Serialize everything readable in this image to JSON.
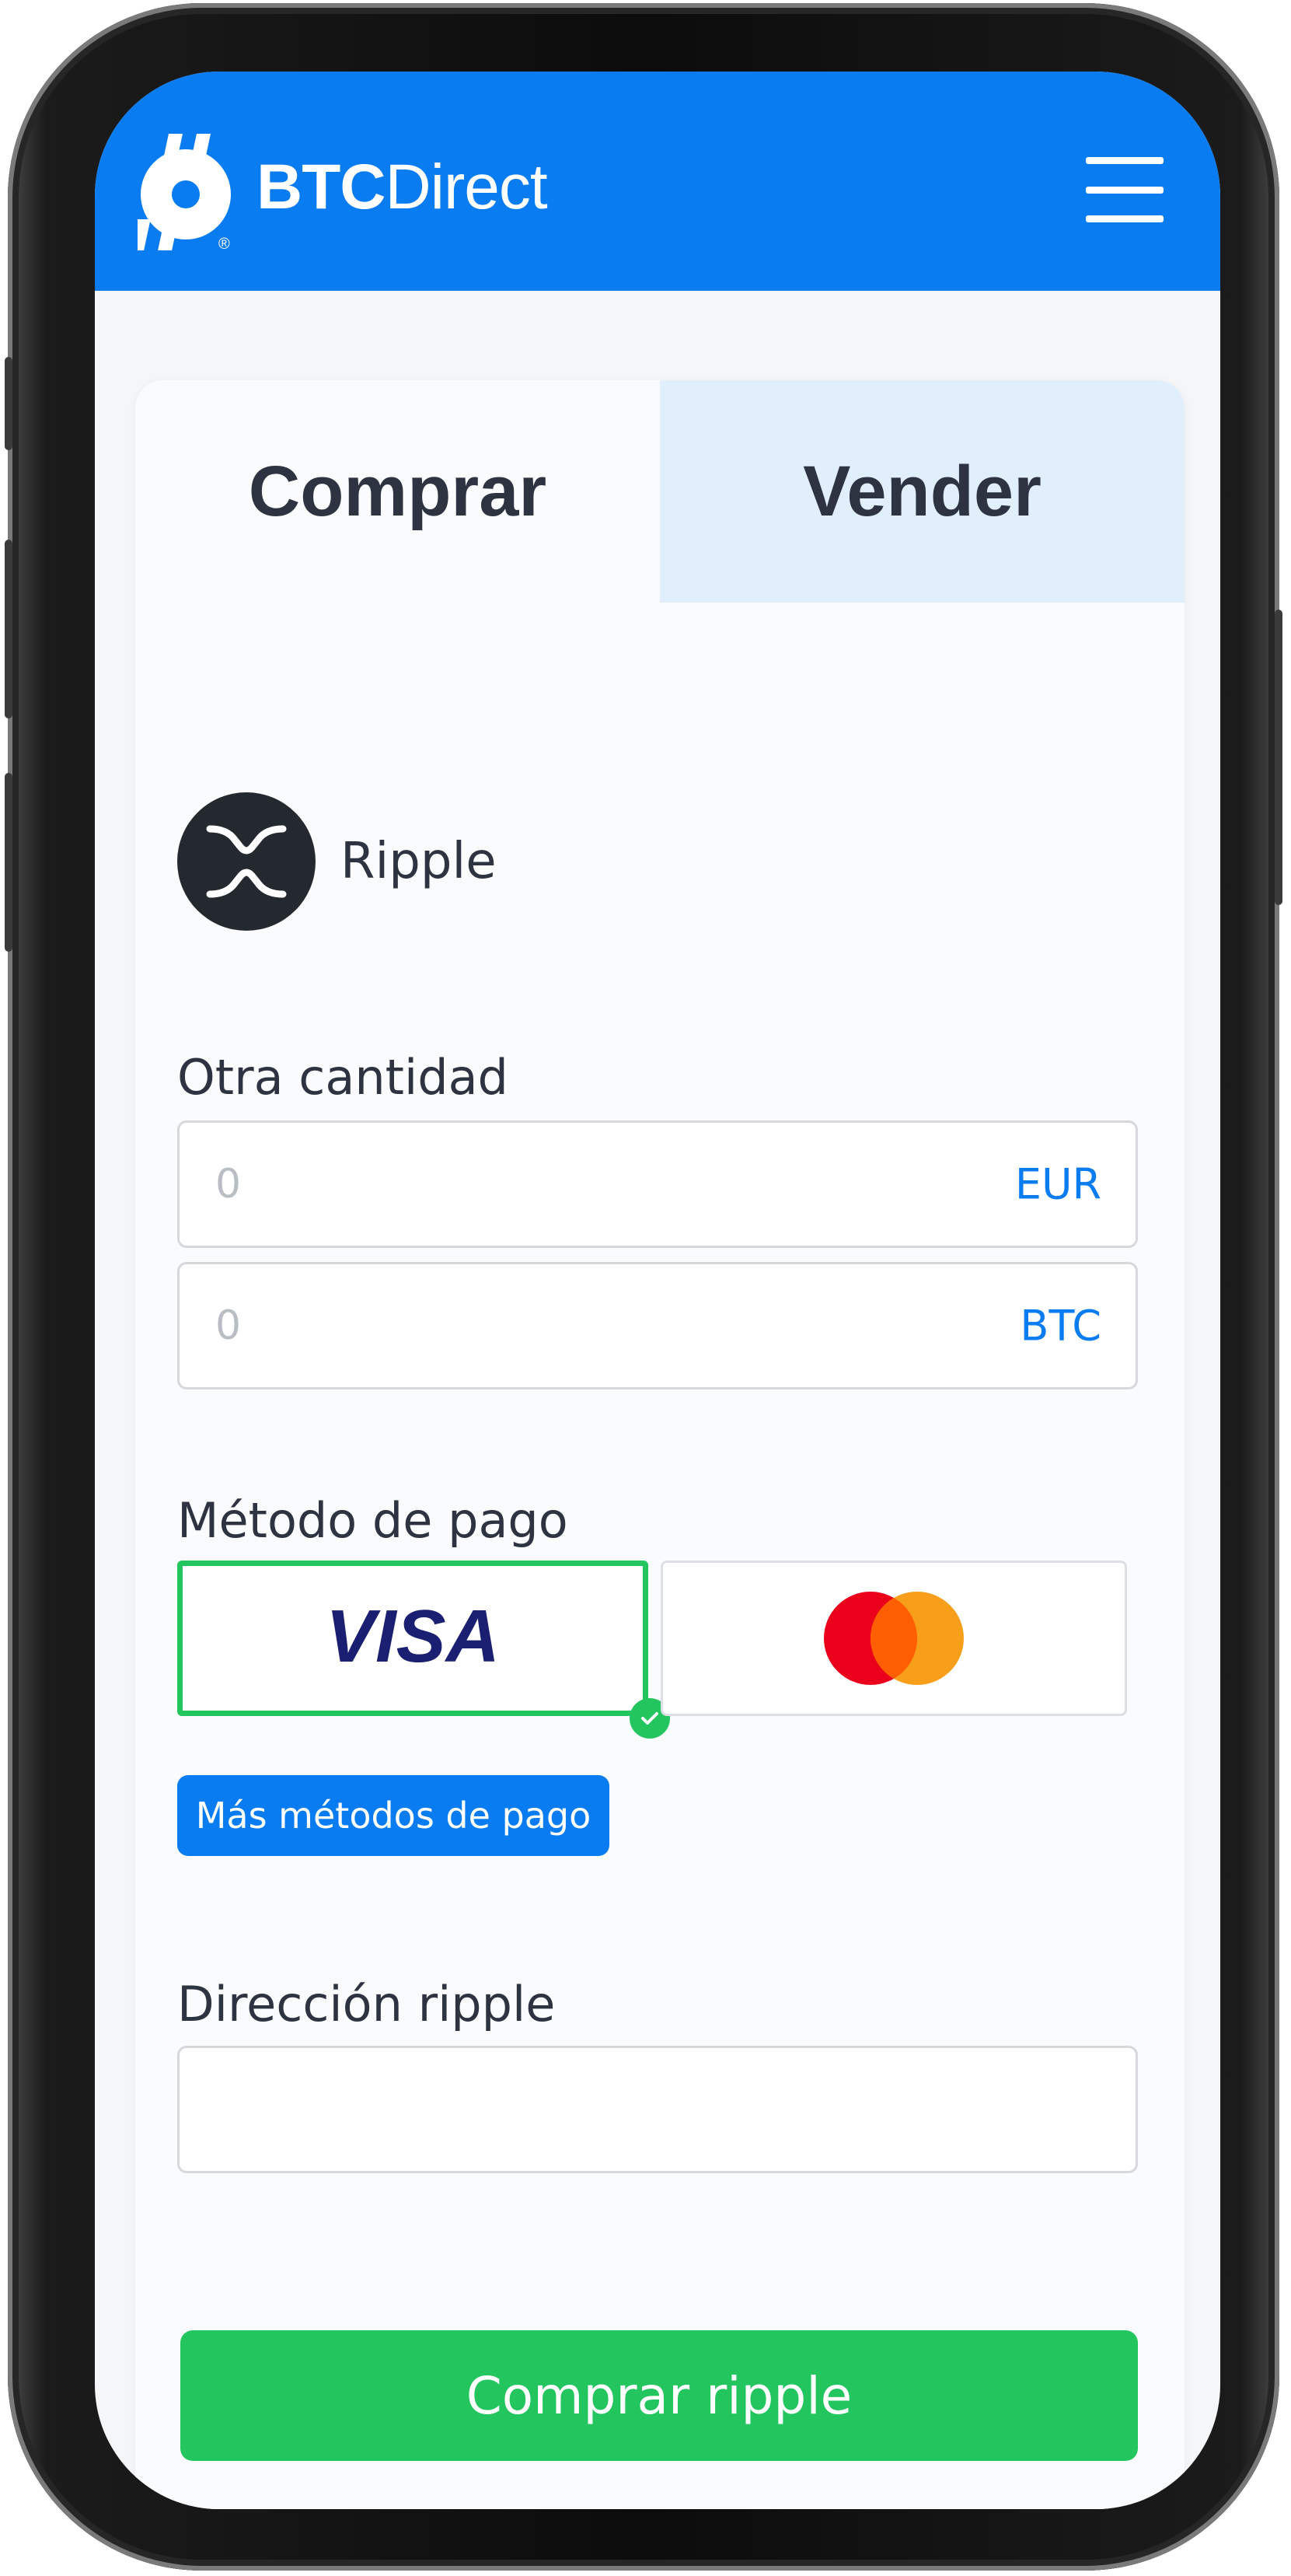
{
  "header": {
    "brand_bold": "BTC",
    "brand_light": "Direct",
    "logo_mark": "®"
  },
  "tabs": [
    {
      "label": "Comprar",
      "active": true
    },
    {
      "label": "Vender",
      "active": false
    }
  ],
  "coin": {
    "name": "Ripple",
    "icon": "xrp-icon"
  },
  "amount": {
    "label": "Otra cantidad",
    "fiat": {
      "value": "0",
      "unit": "EUR"
    },
    "crypto": {
      "value": "0",
      "unit": "BTC"
    }
  },
  "payment": {
    "label": "Método de pago",
    "visa_label": "VISA",
    "selected": "visa",
    "more_button": "Más métodos de pago"
  },
  "address": {
    "label": "Dirección ripple",
    "value": ""
  },
  "cta": {
    "label": "Comprar ripple"
  },
  "colors": {
    "brand_blue": "#0a7cf2",
    "success_green": "#22c55e",
    "tab_inactive_bg": "#e1eefc",
    "visa_blue": "#1a1f71",
    "mc_red": "#eb001b",
    "mc_orange": "#f79e1b"
  }
}
